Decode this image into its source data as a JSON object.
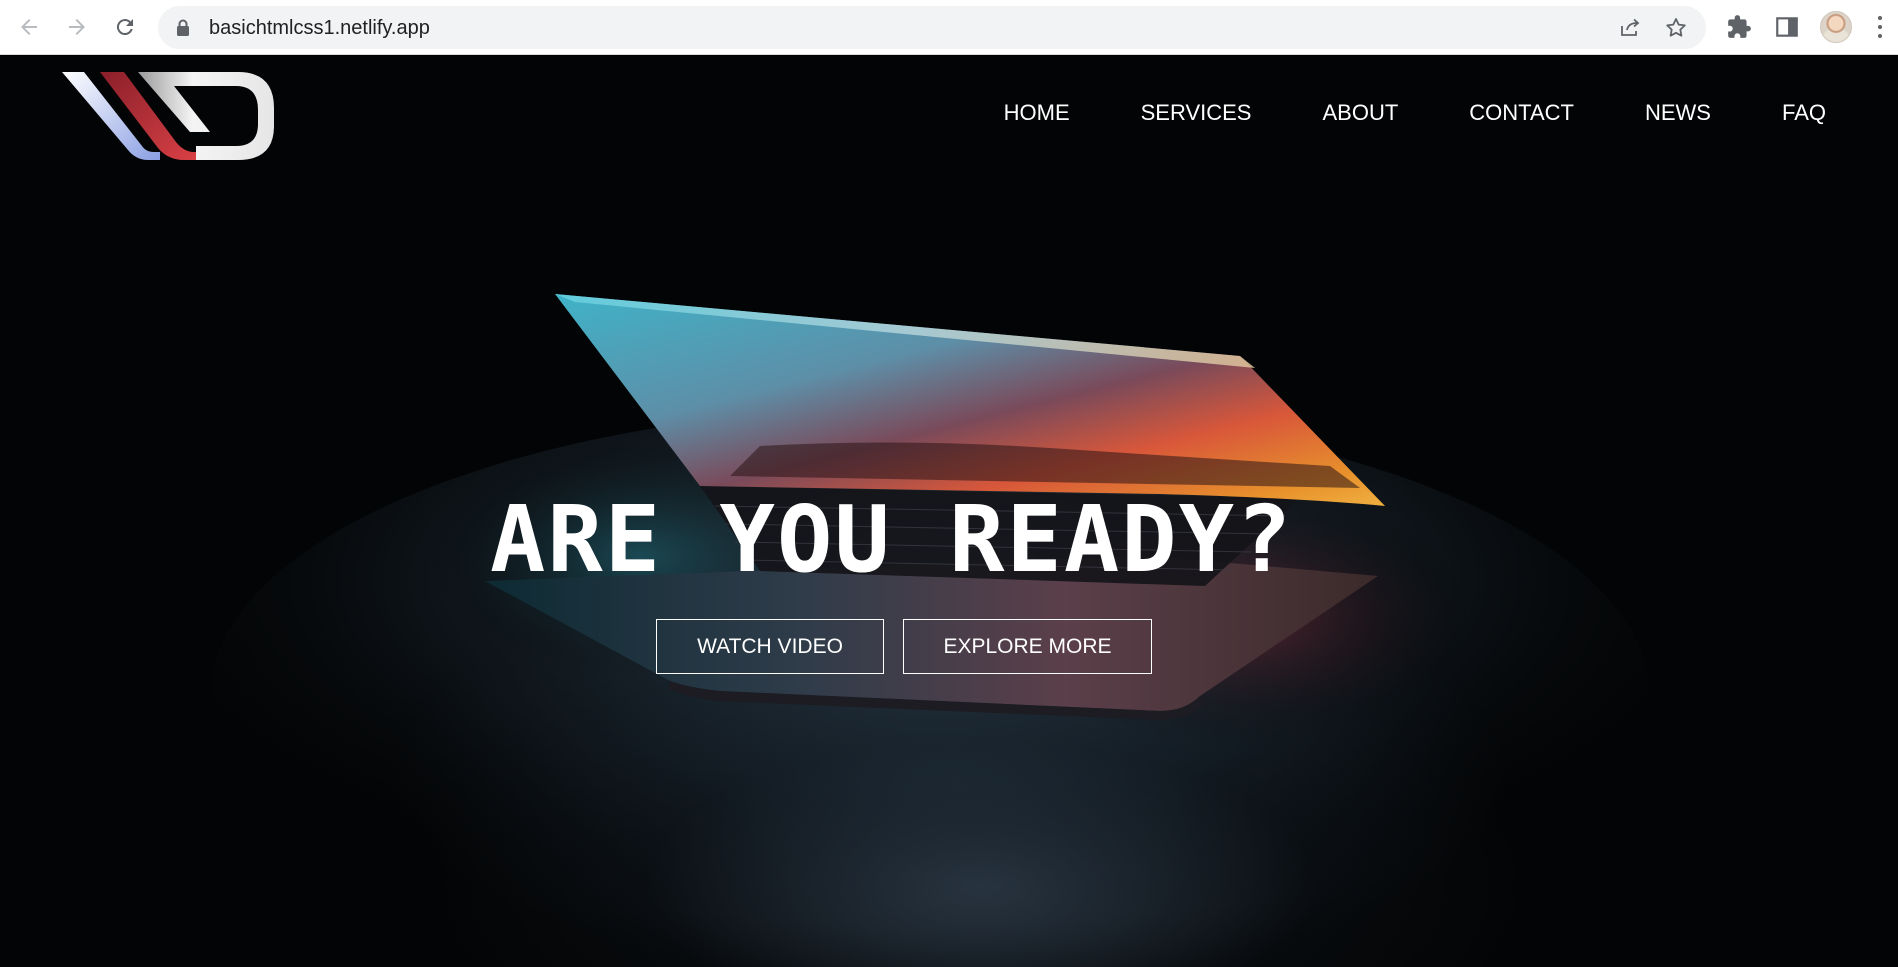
{
  "browser": {
    "url": "basichtmlcss1.netlify.app",
    "icons": [
      "back-arrow-icon",
      "forward-arrow-icon",
      "reload-icon",
      "lock-icon",
      "share-icon",
      "bookmark-star-icon",
      "extensions-puzzle-icon",
      "side-panel-icon",
      "profile-avatar",
      "menu-kebab-icon"
    ]
  },
  "site": {
    "nav": {
      "home": "HOME",
      "services": "SERVICES",
      "about": "ABOUT",
      "contact": "CONTACT",
      "news": "NEWS",
      "faq": "FAQ"
    },
    "hero": {
      "title": "ARE YOU READY?",
      "watch_label": "WATCH VIDEO",
      "explore_label": "EXPLORE MORE"
    },
    "colors": {
      "background": "#030405",
      "text": "#ffffff",
      "logo_blue": "#8b9fe3",
      "logo_red": "#c8323a",
      "logo_white": "#f2f2f2"
    }
  }
}
